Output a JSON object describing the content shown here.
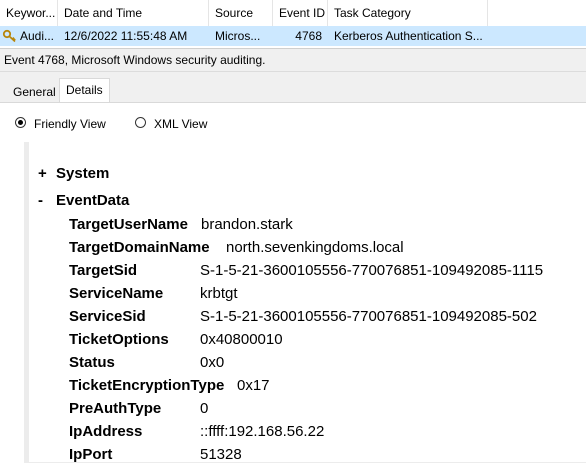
{
  "event_list": {
    "columns": [
      "Keywor...",
      "Date and Time",
      "Source",
      "Event ID",
      "Task Category"
    ],
    "selected_row": {
      "icon": "key-icon",
      "keywords": "Audi...",
      "date_time": "12/6/2022 11:55:48 AM",
      "source": "Micros...",
      "event_id": "4768",
      "task_category": "Kerberos Authentication S..."
    }
  },
  "description": "Event 4768, Microsoft Windows security auditing.",
  "tabs": [
    {
      "label": "General",
      "active": false
    },
    {
      "label": "Details",
      "active": true
    }
  ],
  "view_options": {
    "friendly": {
      "label": "Friendly View",
      "selected": true
    },
    "xml": {
      "label": "XML View",
      "selected": false
    }
  },
  "details": {
    "system": {
      "toggle": "+",
      "label": "System"
    },
    "eventdata": {
      "toggle": "-",
      "label": "EventData"
    },
    "fields": [
      {
        "name": "TargetUserName",
        "value": "brandon.stark"
      },
      {
        "name": "TargetDomainName",
        "value": "north.sevenkingdoms.local"
      },
      {
        "name": "TargetSid",
        "value": "S-1-5-21-3600105556-770076851-109492085-1115"
      },
      {
        "name": "ServiceName",
        "value": "krbtgt"
      },
      {
        "name": "ServiceSid",
        "value": "S-1-5-21-3600105556-770076851-109492085-502"
      },
      {
        "name": "TicketOptions",
        "value": "0x40800010"
      },
      {
        "name": "Status",
        "value": "0x0"
      },
      {
        "name": "TicketEncryptionType",
        "value": "0x17"
      },
      {
        "name": "PreAuthType",
        "value": "0"
      },
      {
        "name": "IpAddress",
        "value": "::ffff:192.168.56.22"
      },
      {
        "name": "IpPort",
        "value": "51328"
      }
    ]
  }
}
